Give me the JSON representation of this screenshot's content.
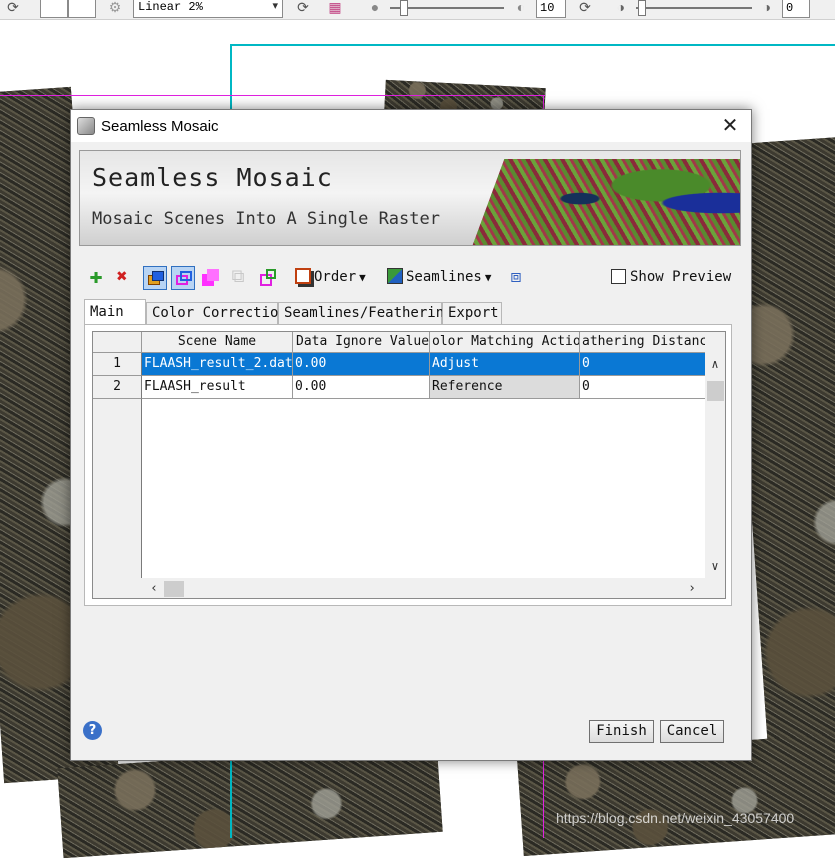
{
  "toolbar": {
    "stretch_value": "Linear 2%",
    "sharpen_value": "10",
    "transparency_value": "0"
  },
  "dialog": {
    "title": "Seamless Mosaic",
    "banner_title": "Seamless Mosaic",
    "banner_subtitle": "Mosaic Scenes Into A Single Raster",
    "tools": {
      "order_label": "Order",
      "seamlines_label": "Seamlines",
      "show_preview_label": "Show Preview"
    },
    "tabs": [
      {
        "label": "Main"
      },
      {
        "label": "Color Correction"
      },
      {
        "label": "Seamlines/Feathering"
      },
      {
        "label": "Export"
      }
    ],
    "table": {
      "columns": [
        "Scene Name",
        "Data Ignore Value",
        "olor Matching Actio",
        "athering Distanc"
      ],
      "rows": [
        {
          "no": "1",
          "scene": "FLAASH_result_2.dat",
          "ignore": "0.00",
          "action": "Adjust",
          "feather": "0"
        },
        {
          "no": "2",
          "scene": "FLAASH_result",
          "ignore": "0.00",
          "action": "Reference",
          "feather": "0"
        }
      ]
    },
    "buttons": {
      "finish": "Finish",
      "cancel": "Cancel"
    }
  },
  "watermark": "https://blog.csdn.net/weixin_43057400"
}
